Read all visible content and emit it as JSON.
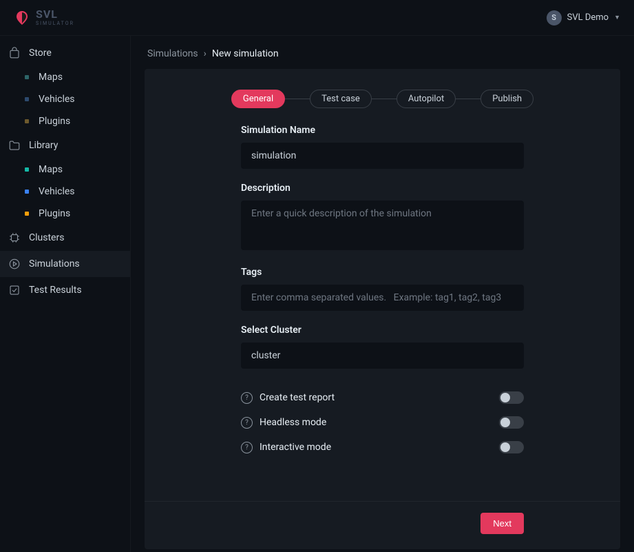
{
  "brand": {
    "name": "SVL",
    "subtitle": "SIMULATOR"
  },
  "user": {
    "initial": "S",
    "name": "SVL Demo"
  },
  "sidebar": {
    "store": {
      "label": "Store",
      "items": [
        "Maps",
        "Vehicles",
        "Plugins"
      ]
    },
    "library": {
      "label": "Library",
      "items": [
        "Maps",
        "Vehicles",
        "Plugins"
      ]
    },
    "clusters": "Clusters",
    "simulations": "Simulations",
    "testresults": "Test Results"
  },
  "breadcrumb": {
    "parent": "Simulations",
    "current": "New simulation"
  },
  "steps": [
    "General",
    "Test case",
    "Autopilot",
    "Publish"
  ],
  "form": {
    "name_label": "Simulation Name",
    "name_value": "simulation",
    "desc_label": "Description",
    "desc_placeholder": "Enter a quick description of the simulation",
    "tags_label": "Tags",
    "tags_placeholder": "Enter comma separated values.   Example: tag1, tag2, tag3",
    "cluster_label": "Select Cluster",
    "cluster_value": "cluster",
    "toggles": [
      {
        "label": "Create test report",
        "on": false
      },
      {
        "label": "Headless mode",
        "on": false
      },
      {
        "label": "Interactive mode",
        "on": false
      }
    ]
  },
  "next_label": "Next"
}
